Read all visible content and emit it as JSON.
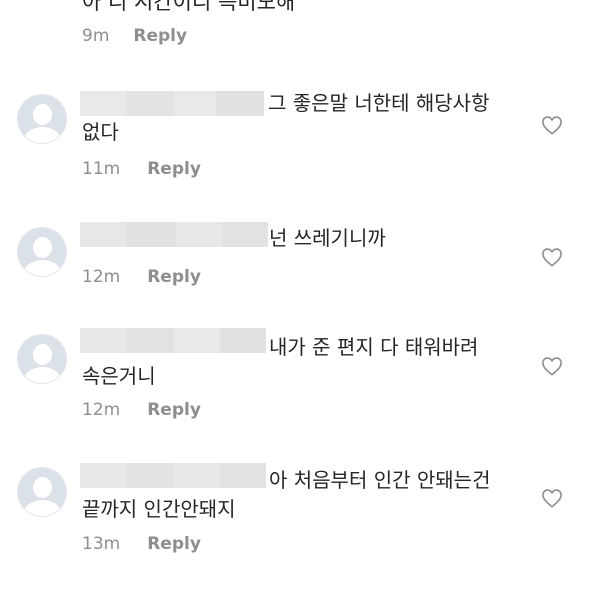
{
  "top": {
    "text": "아 리 시간이리 득비모해",
    "time": "9m",
    "reply": "Reply"
  },
  "comments": [
    {
      "line1": "그  좋은말 너한테 해당사항",
      "line2": "없다",
      "time": "11m",
      "reply": "Reply"
    },
    {
      "line1": "넌  쓰레기니까",
      "line2": "",
      "time": "12m",
      "reply": "Reply"
    },
    {
      "line1": "내가  준 편지  다 태워바려",
      "line2": "속은거니",
      "time": "12m",
      "reply": "Reply"
    },
    {
      "line1": "아 처음부터 인간  안돼는건",
      "line2": "끝까지  인간안돼지",
      "time": "13m",
      "reply": "Reply"
    }
  ],
  "icons": {
    "avatar": "default-avatar-icon",
    "like": "heart-outline-icon"
  },
  "colors": {
    "text": "#262626",
    "meta": "#8e8e8e",
    "redaction": "#e5e5e5"
  }
}
